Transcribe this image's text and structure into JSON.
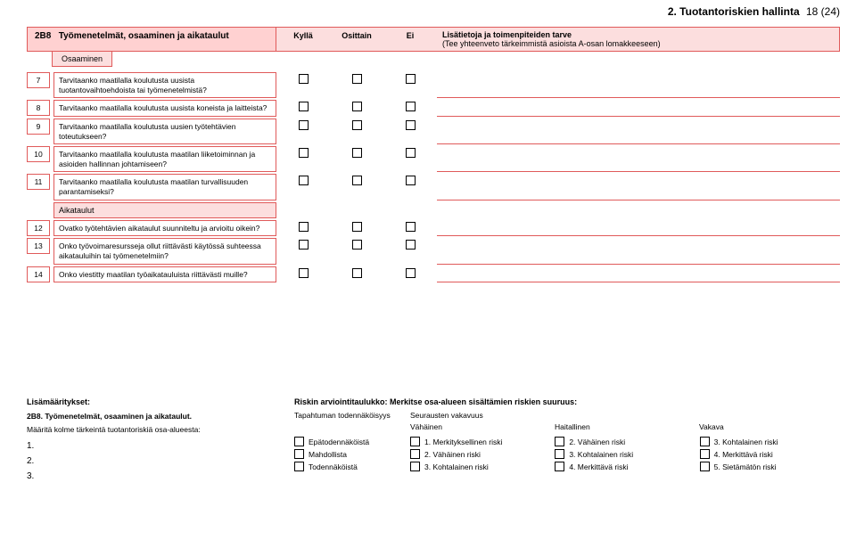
{
  "page": {
    "section_title": "2. Tuotantoriskien hallinta",
    "page_indicator": "18 (24)"
  },
  "block": {
    "code": "2B8",
    "title": "Työmenetelmät, osaaminen ja aikataulut",
    "cols": {
      "yes": "Kyllä",
      "partial": "Osittain",
      "no": "Ei"
    },
    "info_line1": "Lisätietoja ja toimenpiteiden tarve",
    "info_line2": "(Tee yhteenveto tärkeimmistä asioista A-osan lomakkeeseen)",
    "sub1": "Osaaminen",
    "sub2": "Aikataulut"
  },
  "questions_a": [
    {
      "n": "7",
      "t": "Tarvitaanko maatilalla koulutusta uusista tuotantovaihtoehdoista tai työmenetelmistä?"
    },
    {
      "n": "8",
      "t": "Tarvitaanko maatilalla koulutusta uusista koneista ja laitteista?"
    },
    {
      "n": "9",
      "t": "Tarvitaanko maatilalla koulutusta uusien työtehtävien toteutukseen?"
    },
    {
      "n": "10",
      "t": "Tarvitaanko maatilalla koulutusta maatilan liiketoiminnan ja asioiden hallinnan johtamiseen?"
    },
    {
      "n": "11",
      "t": "Tarvitaanko maatilalla koulutusta maatilan turvallisuuden parantamiseksi?"
    }
  ],
  "questions_b": [
    {
      "n": "12",
      "t": "Ovatko työtehtävien aikataulut suunniteltu ja arvioitu oikein?"
    },
    {
      "n": "13",
      "t": "Onko työvoimaresursseja ollut riittävästi käytössä suhteessa aikatauluihin tai työmenetelmiin?"
    },
    {
      "n": "14",
      "t": "Onko viestitty maatilan työaikatauluista riittävästi muille?"
    }
  ],
  "bottom": {
    "head": "Lisämääritykset:",
    "sub_title": "2B8. Työmenetelmät, osaaminen ja aikataulut.",
    "desc": "Määritä kolme tärkeintä tuotantoriskiä osa-alueesta:",
    "nums": [
      "1.",
      "2.",
      "3."
    ]
  },
  "matrix": {
    "title": "Riskin arviointitaulukko: Merkitse osa-alueen sisältämien riskien suuruus:",
    "prob_head": "Tapahtuman todennäköisyys",
    "sev_head": "Seurausten vakavuus",
    "sev_cols": [
      "Vähäinen",
      "Haitallinen",
      "Vakava"
    ],
    "rows": [
      {
        "prob": "Epätodennäköistä",
        "cells": [
          "1. Merkityksellinen riski",
          "2. Vähäinen riski",
          "3. Kohtalainen riski"
        ]
      },
      {
        "prob": "Mahdollista",
        "cells": [
          "2. Vähäinen riski",
          "3. Kohtalainen riski",
          "4. Merkittävä riski"
        ]
      },
      {
        "prob": "Todennäköistä",
        "cells": [
          "3. Kohtalainen riski",
          "4. Merkittävä riski",
          "5. Sietämätön riski"
        ]
      }
    ]
  }
}
